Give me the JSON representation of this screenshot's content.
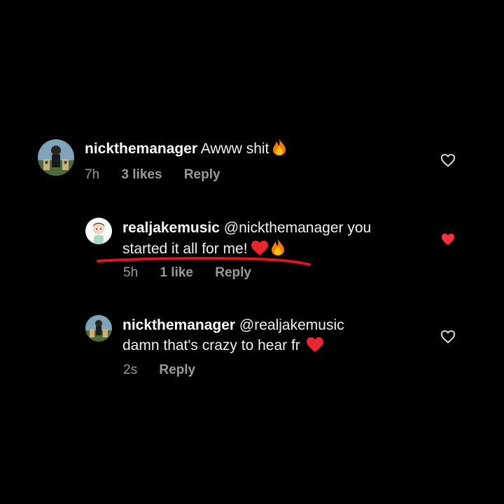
{
  "comments": [
    {
      "username": "nickthemanager",
      "text": "Awww shit",
      "emoji": [
        "fire-emoji"
      ],
      "time": "7h",
      "likes": "3 likes",
      "reply": "Reply",
      "liked": false
    },
    {
      "username": "realjakemusic",
      "text_line1": "@nickthemanager you",
      "text_line2": "started it all for me!",
      "emoji": [
        "heart-emoji",
        "fire-emoji"
      ],
      "time": "5h",
      "likes": "1 like",
      "reply": "Reply",
      "liked": true,
      "annotation": "red-underline"
    },
    {
      "username": "nickthemanager",
      "text_line1": "@realjakemusic",
      "text_line2": "damn that's crazy to hear fr",
      "emoji": [
        "heart-emoji"
      ],
      "time": "2s",
      "reply": "Reply",
      "liked": false
    }
  ],
  "colors": {
    "background": "#000000",
    "meta": "#9a9a9a",
    "liked_heart": "#ff3040",
    "underline": "#e0141e"
  }
}
